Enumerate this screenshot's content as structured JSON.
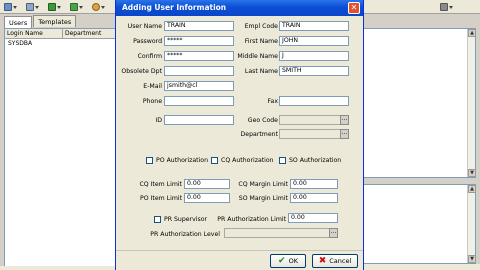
{
  "left": {
    "tabs": [
      "Users",
      "Templates"
    ],
    "columns": [
      "Login Name",
      "Department"
    ],
    "rows": [
      "SYSDBA"
    ]
  },
  "dialog": {
    "title": "Adding User Information",
    "labels": {
      "user_name": "User Name",
      "empl_code": "Empl Code",
      "password": "Password",
      "first_name": "First Name",
      "confirm": "Confirm",
      "middle_name": "Middle Name",
      "obsolete_dpt": "Obsolete Dpt",
      "last_name": "Last Name",
      "email": "E-Mail",
      "phone": "Phone",
      "fax": "Fax",
      "id": "ID",
      "geo_code": "Geo Code",
      "department": "Department",
      "po_auth": "PO Authorization",
      "cq_auth": "CQ Authorization",
      "so_auth": "SO Authorization",
      "cq_item_limit": "CQ Item Limit",
      "cq_margin_limit": "CQ Margin Limit",
      "po_item_limit": "PO Item Limit",
      "so_margin_limit": "SO Margin Limit",
      "pr_supervisor": "PR Supervisor",
      "pr_auth_limit": "PR Authorization Limit",
      "pr_auth_level": "PR Authorization Level"
    },
    "values": {
      "user_name": "TRAIN",
      "empl_code": "TRAIN",
      "password": "*****",
      "first_name": "JOHN",
      "confirm": "*****",
      "middle_name": "J",
      "obsolete_dpt": "",
      "last_name": "SMITH",
      "email": "jsmith@cl",
      "phone": "",
      "fax": "",
      "id": "",
      "geo_code": "",
      "department": "",
      "cq_item_limit": "0.00",
      "cq_margin_limit": "0.00",
      "po_item_limit": "0.00",
      "so_margin_limit": "0.00",
      "pr_auth_limit": "0.00",
      "pr_auth_level": ""
    },
    "buttons": {
      "ok": "OK",
      "cancel": "Cancel"
    }
  },
  "icons": [
    "toolbar-new-icon",
    "toolbar-edit-icon",
    "toolbar-grid-icon",
    "toolbar-export-icon",
    "toolbar-refresh-icon",
    "toolbar-print-icon"
  ],
  "colors": {
    "titlebar": "#0a4fd6",
    "dialog_bg": "#ece9d8",
    "close": "#e3512c"
  }
}
